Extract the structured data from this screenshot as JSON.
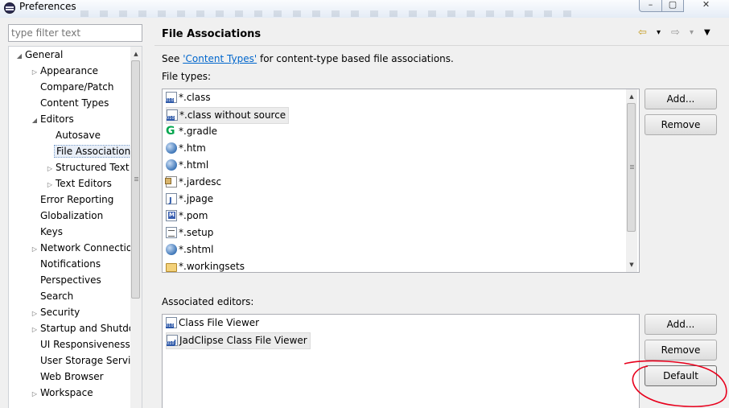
{
  "window": {
    "title": "Preferences"
  },
  "filter": {
    "placeholder": "type filter text"
  },
  "tree": {
    "items": [
      {
        "label": "General",
        "level": 0,
        "toggle": "open"
      },
      {
        "label": "Appearance",
        "level": 1,
        "toggle": "closed"
      },
      {
        "label": "Compare/Patch",
        "level": 1,
        "toggle": "none"
      },
      {
        "label": "Content Types",
        "level": 1,
        "toggle": "none"
      },
      {
        "label": "Editors",
        "level": 1,
        "toggle": "open"
      },
      {
        "label": "Autosave",
        "level": 2,
        "toggle": "none"
      },
      {
        "label": "File Associations",
        "level": 2,
        "toggle": "none",
        "selected": true
      },
      {
        "label": "Structured Text",
        "level": 2,
        "toggle": "closed"
      },
      {
        "label": "Text Editors",
        "level": 2,
        "toggle": "closed"
      },
      {
        "label": "Error Reporting",
        "level": 1,
        "toggle": "none"
      },
      {
        "label": "Globalization",
        "level": 1,
        "toggle": "none"
      },
      {
        "label": "Keys",
        "level": 1,
        "toggle": "none"
      },
      {
        "label": "Network Connections",
        "level": 1,
        "toggle": "closed"
      },
      {
        "label": "Notifications",
        "level": 1,
        "toggle": "none"
      },
      {
        "label": "Perspectives",
        "level": 1,
        "toggle": "none"
      },
      {
        "label": "Search",
        "level": 1,
        "toggle": "none"
      },
      {
        "label": "Security",
        "level": 1,
        "toggle": "closed"
      },
      {
        "label": "Startup and Shutdown",
        "level": 1,
        "toggle": "closed"
      },
      {
        "label": "UI Responsiveness",
        "level": 1,
        "toggle": "none"
      },
      {
        "label": "User Storage Service",
        "level": 1,
        "toggle": "none"
      },
      {
        "label": "Web Browser",
        "level": 1,
        "toggle": "none"
      },
      {
        "label": "Workspace",
        "level": 1,
        "toggle": "closed"
      }
    ]
  },
  "page": {
    "title": "File Associations",
    "desc_prefix": "See ",
    "desc_link": "'Content Types'",
    "desc_suffix": " for content-type based file associations.",
    "file_types_label": "File types:",
    "associated_label": "Associated editors:"
  },
  "file_types": [
    {
      "label": "*.class",
      "icon": "class-file-icon"
    },
    {
      "label": "*.class without source",
      "icon": "class-file-icon",
      "selected": true
    },
    {
      "label": "*.gradle",
      "icon": "gradle-icon"
    },
    {
      "label": "*.htm",
      "icon": "globe-icon"
    },
    {
      "label": "*.html",
      "icon": "globe-icon"
    },
    {
      "label": "*.jardesc",
      "icon": "jar-desc-icon"
    },
    {
      "label": "*.jpage",
      "icon": "java-page-icon"
    },
    {
      "label": "*.pom",
      "icon": "maven-pom-icon"
    },
    {
      "label": "*.setup",
      "icon": "setup-file-icon"
    },
    {
      "label": "*.shtml",
      "icon": "globe-icon"
    },
    {
      "label": "*.workingsets",
      "icon": "folder-icon"
    }
  ],
  "editors": [
    {
      "label": "Class File Viewer",
      "icon": "class-file-icon"
    },
    {
      "label": "JadClipse Class File Viewer",
      "icon": "jadclipse-icon",
      "selected": true
    }
  ],
  "buttons": {
    "file_add": "Add...",
    "file_remove": "Remove",
    "editor_add": "Add...",
    "editor_remove": "Remove",
    "editor_default": "Default"
  },
  "nav": {
    "back": "⇦",
    "dropdown": "▾",
    "forward": "⇨",
    "menu": "▼"
  },
  "annotation_color": "#e8001c"
}
